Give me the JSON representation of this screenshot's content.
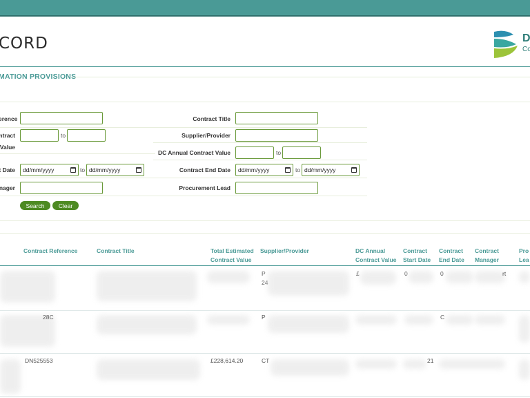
{
  "header": {
    "brand": "CORD",
    "logo_text": "D",
    "logo_sub": "Co",
    "section_title": "MATION PROVISIONS"
  },
  "search": {
    "labels": {
      "reference": "erence",
      "contract_value_1": "ntract",
      "contract_value_2": "Value",
      "start_date": "t Date",
      "manager": "nager",
      "contract_title": "Contract Title",
      "supplier": "Supplier/Provider",
      "dc_annual": "DC Annual Contract Value",
      "end_date": "Contract End Date",
      "procurement_lead": "Procurement Lead"
    },
    "to": "to",
    "date_placeholder": "dd/mm/yyyy",
    "search_button": "Search",
    "clear_button": "Clear"
  },
  "table": {
    "headers": [
      {
        "line1": "Contract Reference",
        "line2": ""
      },
      {
        "line1": "Contract Title",
        "line2": ""
      },
      {
        "line1": "Total Estimated",
        "line2": "Contract Value"
      },
      {
        "line1": "Supplier/Provider",
        "line2": ""
      },
      {
        "line1": "DC Annual",
        "line2": "Contract Value"
      },
      {
        "line1": "Contract",
        "line2": "Start Date"
      },
      {
        "line1": "Contract",
        "line2": "End Date"
      },
      {
        "line1": "Contract",
        "line2": "Manager"
      },
      {
        "line1": "Pro",
        "line2": "Lea"
      }
    ],
    "rows": [
      {
        "supplier": "P",
        "supplier2": "24",
        "dc": "£",
        "start": "0",
        "end": "0",
        "manager": "rt"
      },
      {
        "ref": "28C",
        "supplier": "P",
        "start": "",
        "end": "C"
      },
      {
        "ref": "DN525553",
        "total": "£228,614.20",
        "supplier": "CT",
        "start": "21"
      }
    ]
  },
  "colors": {
    "topbar": "#4a9a96",
    "accent": "#4a9a96",
    "button": "#4d8a22",
    "input_border": "#6a9a3a"
  }
}
